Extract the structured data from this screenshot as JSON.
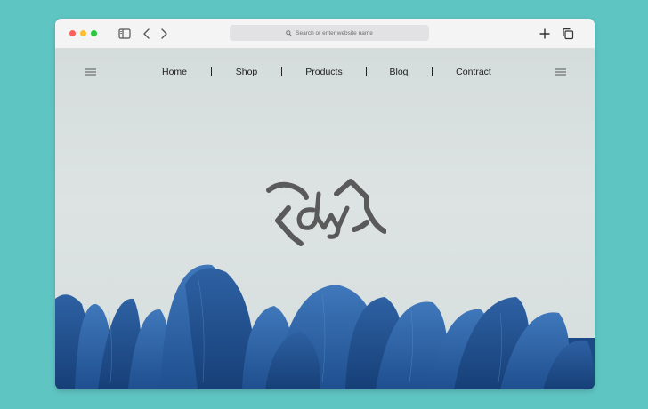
{
  "browser": {
    "url_placeholder": "Search or enter website name",
    "traffic_lights": {
      "close": "#fe5f57",
      "minimize": "#febc2e",
      "maximize": "#28c840"
    },
    "toolbar_icons": [
      "sidebar-icon",
      "back-icon",
      "forward-icon",
      "search-icon",
      "new-tab-icon",
      "tabs-overview-icon"
    ]
  },
  "nav": {
    "items": [
      {
        "label": "Home"
      },
      {
        "label": "Shop"
      },
      {
        "label": "Products"
      },
      {
        "label": "Blog"
      },
      {
        "label": "Contract"
      }
    ]
  },
  "hero": {
    "logo_text": "dw",
    "background_color": "#d7dddd",
    "flower_color": "#2f64a8"
  },
  "colors": {
    "page_bg": "#5fc5c3",
    "logo": "#5a5a5a"
  }
}
